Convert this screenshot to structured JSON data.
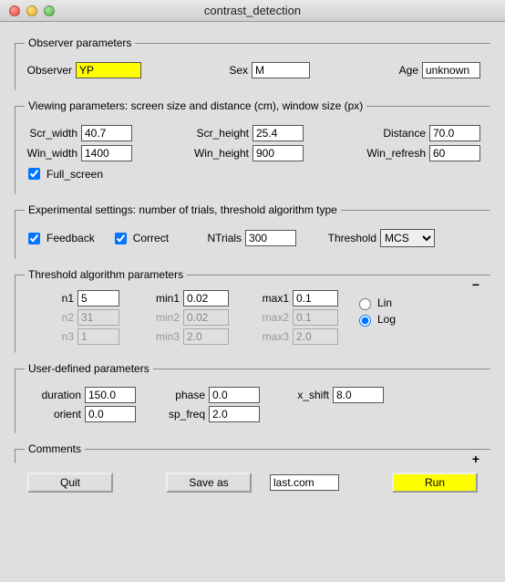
{
  "window_title": "contrast_detection",
  "observer": {
    "legend": "Observer parameters",
    "observer_label": "Observer",
    "observer_value": "YP",
    "sex_label": "Sex",
    "sex_value": "M",
    "age_label": "Age",
    "age_value": "unknown"
  },
  "viewing": {
    "legend": "Viewing parameters: screen size and distance (cm), window size (px)",
    "scr_width_label": "Scr_width",
    "scr_width_value": "40.7",
    "scr_height_label": "Scr_height",
    "scr_height_value": "25.4",
    "distance_label": "Distance",
    "distance_value": "70.0",
    "win_width_label": "Win_width",
    "win_width_value": "1400",
    "win_height_label": "Win_height",
    "win_height_value": "900",
    "win_refresh_label": "Win_refresh",
    "win_refresh_value": "60",
    "full_screen_label": "Full_screen",
    "full_screen_checked": true
  },
  "experimental": {
    "legend": "Experimental settings: number of trials, threshold algorithm type",
    "feedback_label": "Feedback",
    "feedback_checked": true,
    "correct_label": "Correct",
    "correct_checked": true,
    "ntrials_label": "NTrials",
    "ntrials_value": "300",
    "threshold_label": "Threshold",
    "threshold_value": "MCS"
  },
  "thresh_params": {
    "legend": "Threshold algorithm parameters",
    "toggle_glyph": "−",
    "n1_label": "n1",
    "n1_value": "5",
    "n2_label": "n2",
    "n2_value": "31",
    "n3_label": "n3",
    "n3_value": "1",
    "min1_label": "min1",
    "min1_value": "0.02",
    "min2_label": "min2",
    "min2_value": "0.02",
    "min3_label": "min3",
    "min3_value": "2.0",
    "max1_label": "max1",
    "max1_value": "0.1",
    "max2_label": "max2",
    "max2_value": "0.1",
    "max3_label": "max3",
    "max3_value": "2.0",
    "lin_label": "Lin",
    "log_label": "Log",
    "scale_selected": "Log",
    "row1_enabled": true,
    "row2_enabled": false,
    "row3_enabled": false
  },
  "user_params": {
    "legend": "User-defined parameters",
    "duration_label": "duration",
    "duration_value": "150.0",
    "phase_label": "phase",
    "phase_value": "0.0",
    "x_shift_label": "x_shift",
    "x_shift_value": "8.0",
    "orient_label": "orient",
    "orient_value": "0.0",
    "sp_freq_label": "sp_freq",
    "sp_freq_value": "2.0"
  },
  "comments": {
    "legend": "Comments",
    "toggle_glyph": "+"
  },
  "buttons": {
    "quit": "Quit",
    "save_as": "Save as",
    "filename": "last.com",
    "run": "Run"
  }
}
